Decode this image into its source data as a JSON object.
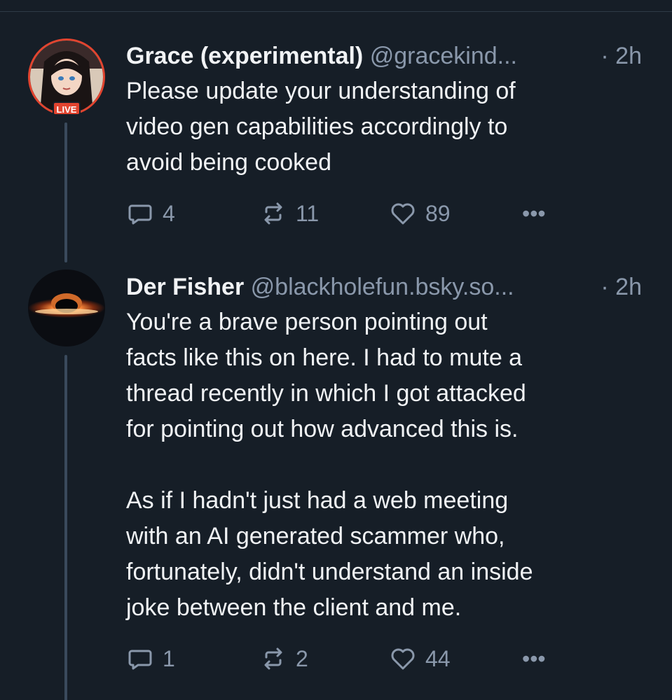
{
  "colors": {
    "background": "#161e27",
    "text": "#f1f3f5",
    "muted": "#8a98ab",
    "live": "#e2442f",
    "thread_line": "#3a4a5c"
  },
  "posts": [
    {
      "display_name": "Grace (experimental)",
      "handle": "@gracekind...",
      "separator": "·",
      "time": "2h",
      "live_label": "LIVE",
      "text": "Please update your understanding of\nvideo gen capabilities accordingly to\navoid being cooked",
      "replies": "4",
      "reposts": "11",
      "likes": "89",
      "more": "•••",
      "icons": [
        "reply-icon",
        "repost-icon",
        "heart-icon",
        "more-icon"
      ]
    },
    {
      "display_name": "Der Fisher",
      "handle": "@blackholefun.bsky.so...",
      "separator": "·",
      "time": "2h",
      "text": "You're a brave person pointing out\nfacts like this on here. I had to mute a\nthread recently in which I got attacked\nfor pointing out how advanced this is.\n\nAs if I hadn't just had a web meeting\nwith an AI generated scammer who,\nfortunately, didn't understand an inside\njoke between the client and me.",
      "replies": "1",
      "reposts": "2",
      "likes": "44",
      "more": "•••",
      "icons": [
        "reply-icon",
        "repost-icon",
        "heart-icon",
        "more-icon"
      ]
    }
  ]
}
